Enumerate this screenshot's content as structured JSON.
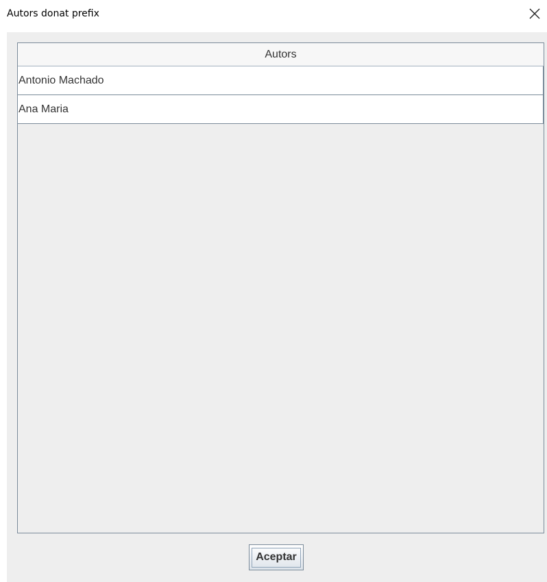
{
  "window": {
    "title": "Autors donat prefix",
    "close_icon": "close-icon"
  },
  "table": {
    "columns": [
      "Autors"
    ],
    "rows": [
      "Antonio Machado",
      "Ana Maria"
    ]
  },
  "footer": {
    "accept_label": "Aceptar"
  }
}
